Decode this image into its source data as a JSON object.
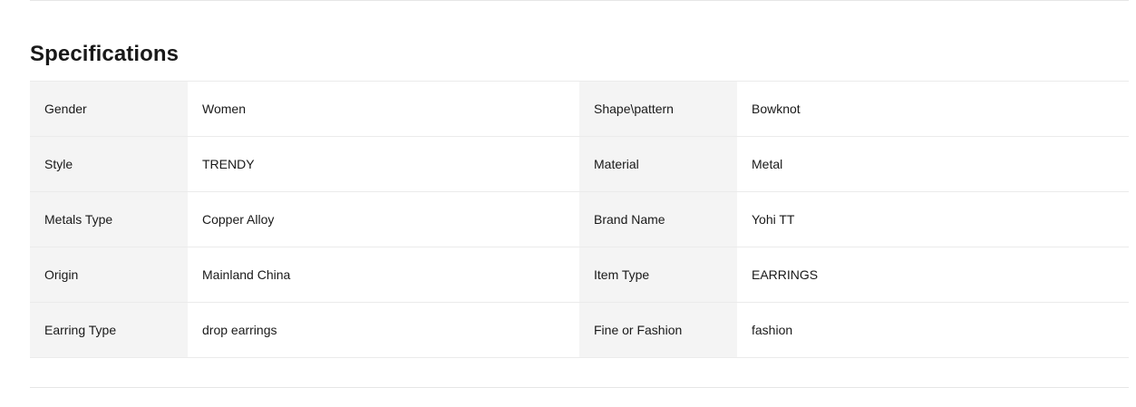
{
  "specifications": {
    "title": "Specifications",
    "rows": [
      {
        "key1": "Gender",
        "value1": "Women",
        "key2": "Shape\\pattern",
        "value2": "Bowknot"
      },
      {
        "key1": "Style",
        "value1": "TRENDY",
        "key2": "Material",
        "value2": "Metal"
      },
      {
        "key1": "Metals Type",
        "value1": "Copper Alloy",
        "key2": "Brand Name",
        "value2": "Yohi TT"
      },
      {
        "key1": "Origin",
        "value1": "Mainland China",
        "key2": "Item Type",
        "value2": "EARRINGS"
      },
      {
        "key1": "Earring Type",
        "value1": "drop earrings",
        "key2": "Fine or Fashion",
        "value2": "fashion"
      }
    ]
  }
}
